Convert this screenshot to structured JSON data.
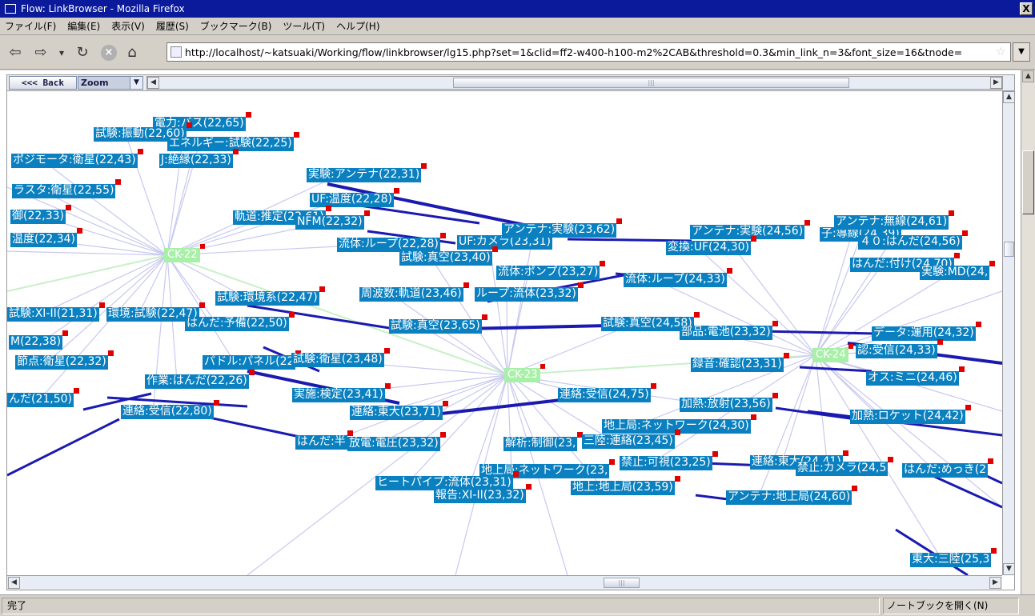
{
  "window": {
    "title": "Flow: LinkBrowser - Mozilla Firefox",
    "close": "X"
  },
  "menu": [
    "ファイル(F)",
    "編集(E)",
    "表示(V)",
    "履歴(S)",
    "ブックマーク(B)",
    "ツール(T)",
    "ヘルプ(H)"
  ],
  "nav": {
    "back_icon": "⇦",
    "forward_icon": "⇨",
    "dropdown_icon": "▾",
    "reload_icon": "↻",
    "stop_icon": "×",
    "home_icon": "⌂",
    "url": "http://localhost/~katsuaki/Working/flow/linkbrowser/lg15.php?set=1&clid=ff2-w400-h100-m2%2CAB&threshold=0.3&min_link_n=3&font_size=16&tnode=",
    "star": "☆",
    "url_dropdown": "▼"
  },
  "applet": {
    "back_label": "<<< Back",
    "zoom_label": "Zoom",
    "zoom_arrow": "▼",
    "left_arrow": "◀",
    "right_arrow": "▶",
    "up_arrow": "▲",
    "down_arrow": "▼",
    "thumb_grip": "|||"
  },
  "graph": {
    "centers": [
      "CK-22",
      "CK-23",
      "CK-24"
    ],
    "nodes": [
      "電力:バス(22,65)",
      "試験:振動(22,60)",
      "エネルギー:試験(22,25)",
      "ポジモータ:衛星(22,43)",
      "J:絶縁(22,33)",
      "実験:アンテナ(22,31)",
      "ラスタ:衛星(22,55)",
      "UF:温度(22,28)",
      "御(22,33)",
      "軌道:推定(22,61)",
      "NFM(22,32)",
      "温度(22,34)",
      "流体:ループ(22,28)",
      "UF:カメラ(23,31)",
      "試験:真空(23,40)",
      "アンテナ:実験(23,62)",
      "アンテナ:実験(24,56)",
      "変換:UF(24,30)",
      "子:導線(24,39)",
      "アンテナ:無線(24,61)",
      "４０:はんだ(24,56)",
      "はんだ:付け(24,70)",
      "実験:MD(24,",
      "流体:ポンプ(23,27)",
      "流体:ループ(24,33)",
      "周波数:軌道(23,46)",
      "ループ:流体(23,32)",
      "試験:環境系(22,47)",
      "試験:XI-II(21,31)",
      "環境:試験(22,47)",
      "はんだ:予備(22,50)",
      "試験:真空(23,65)",
      "試験:真空(24,58)",
      "部品:電池(23,32)",
      "データ:運用(24,32)",
      "M(22,38)",
      "認:受信(24,33)",
      "パドル:パネル(22",
      "試験:衛星(23,48)",
      "節点:衛星(22,32)",
      "録音:確認(23,31)",
      "オス:ミニ(24,46)",
      "作業:はんだ(22,26)",
      "んだ(21,50)",
      "実施:検定(23,41)",
      "連絡:受信(24,75)",
      "加熱:放射(23,56)",
      "連絡:受信(22,80)",
      "連絡:東大(23,71)",
      "加熱:ロケット(24,42)",
      "地上局:ネットワーク(24,30)",
      "はんだ:半",
      "放電:電圧(23,32)",
      "解析:制御(23,",
      "三陸:連絡(23,45)",
      "禁止:可視(23,25)",
      "連絡:東大(24,41)",
      "禁止:カメラ(24,5",
      "はんだ:めっき(2",
      "地上局:ネットワーク(23,",
      "ヒートパイプ:流体(23,31)",
      "地上:地上局(23,59)",
      "アンテナ:地上局(24,60)",
      "報告:XI-II(23,32)",
      "東大:三陸(25,3"
    ]
  },
  "status": {
    "text": "完了",
    "notebook": "ノートブックを開く(N)"
  }
}
